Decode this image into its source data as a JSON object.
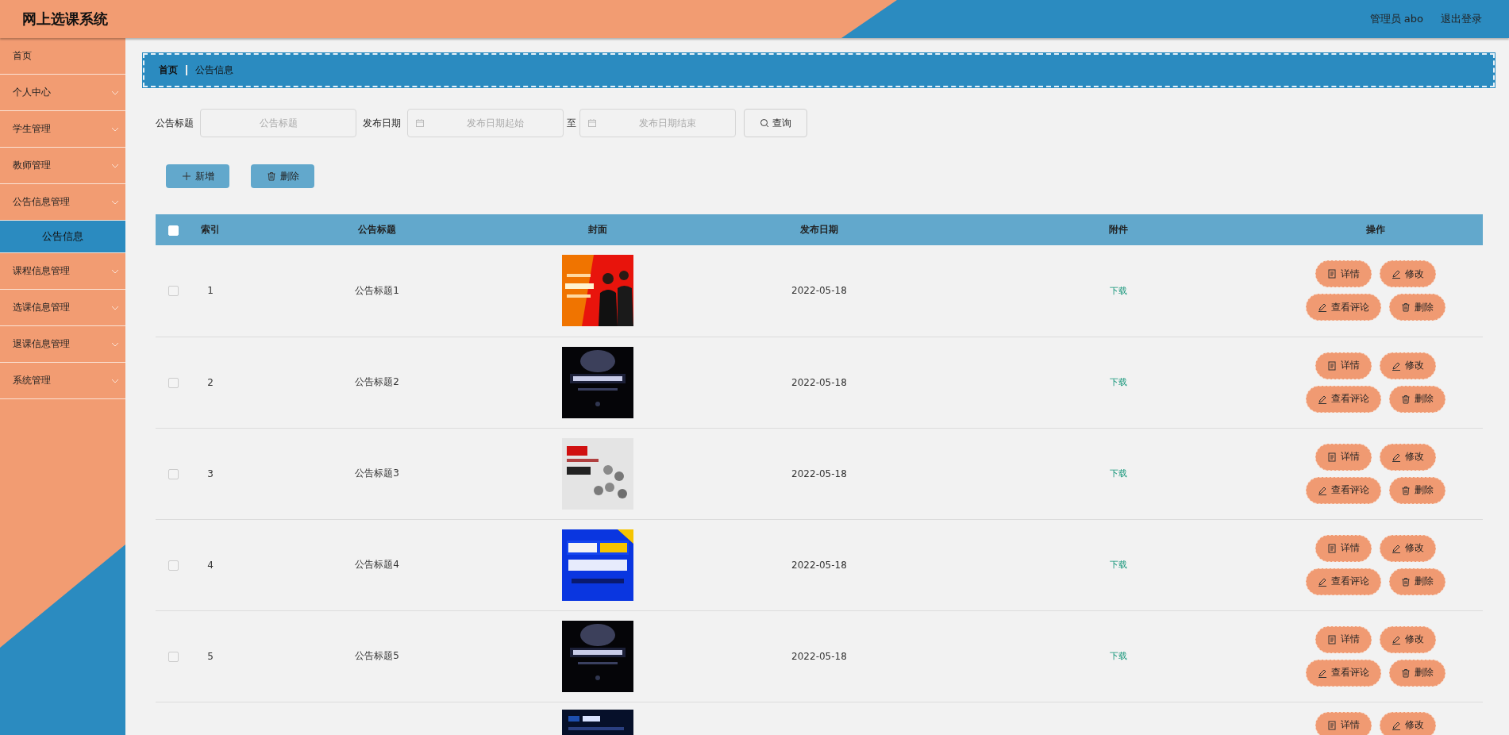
{
  "header": {
    "title": "网上选课系统",
    "user": "管理员 abo",
    "logout": "退出登录"
  },
  "sidebar": {
    "items": [
      {
        "kind": "link",
        "label": "首页"
      },
      {
        "kind": "menu",
        "label": "个人中心"
      },
      {
        "kind": "menu",
        "label": "学生管理"
      },
      {
        "kind": "menu",
        "label": "教师管理"
      },
      {
        "kind": "menu",
        "label": "公告信息管理",
        "children": [
          {
            "label": "公告信息",
            "selected": true
          }
        ]
      },
      {
        "kind": "menu",
        "label": "课程信息管理"
      },
      {
        "kind": "menu",
        "label": "选课信息管理"
      },
      {
        "kind": "menu",
        "label": "退课信息管理"
      },
      {
        "kind": "menu",
        "label": "系统管理"
      }
    ]
  },
  "breadcrumb": [
    "首页",
    "公告信息"
  ],
  "search": {
    "title_label": "公告标题",
    "title_placeholder": "公告标题",
    "date_label": "发布日期",
    "start_placeholder": "发布日期起始",
    "to_label": "至",
    "end_placeholder": "发布日期结束",
    "button": "查询"
  },
  "toolbar": [
    {
      "kind": "add",
      "label": "新增"
    },
    {
      "kind": "delete",
      "label": "删除"
    }
  ],
  "table": {
    "columns": [
      "索引",
      "公告标题",
      "封面",
      "发布日期",
      "附件",
      "操作"
    ],
    "header_checked": false,
    "rows": [
      {
        "checked": false,
        "index": "1",
        "title": "公告标题1",
        "date": "2022-05-18",
        "attachment": "下载",
        "actions": [
          {
            "kind": "detail",
            "label": "详情"
          },
          {
            "kind": "edit",
            "label": "修改"
          },
          {
            "kind": "comments",
            "label": "查看评论"
          },
          {
            "kind": "delete",
            "label": "删除"
          }
        ]
      },
      {
        "checked": false,
        "index": "2",
        "title": "公告标题2",
        "date": "2022-05-18",
        "attachment": "下载",
        "actions": [
          {
            "kind": "detail",
            "label": "详情"
          },
          {
            "kind": "edit",
            "label": "修改"
          },
          {
            "kind": "comments",
            "label": "查看评论"
          },
          {
            "kind": "delete",
            "label": "删除"
          }
        ]
      },
      {
        "checked": false,
        "index": "3",
        "title": "公告标题3",
        "date": "2022-05-18",
        "attachment": "下载",
        "actions": [
          {
            "kind": "detail",
            "label": "详情"
          },
          {
            "kind": "edit",
            "label": "修改"
          },
          {
            "kind": "comments",
            "label": "查看评论"
          },
          {
            "kind": "delete",
            "label": "删除"
          }
        ]
      },
      {
        "checked": false,
        "index": "4",
        "title": "公告标题4",
        "date": "2022-05-18",
        "attachment": "下载",
        "actions": [
          {
            "kind": "detail",
            "label": "详情"
          },
          {
            "kind": "edit",
            "label": "修改"
          },
          {
            "kind": "comments",
            "label": "查看评论"
          },
          {
            "kind": "delete",
            "label": "删除"
          }
        ]
      },
      {
        "checked": false,
        "index": "5",
        "title": "公告标题5",
        "date": "2022-05-18",
        "attachment": "下载",
        "actions": [
          {
            "kind": "detail",
            "label": "详情"
          },
          {
            "kind": "edit",
            "label": "修改"
          },
          {
            "kind": "comments",
            "label": "查看评论"
          },
          {
            "kind": "delete",
            "label": "删除"
          }
        ]
      },
      {
        "actions": [
          {
            "kind": "detail",
            "label": "详情"
          },
          {
            "kind": "edit",
            "label": "修改"
          }
        ]
      }
    ]
  }
}
